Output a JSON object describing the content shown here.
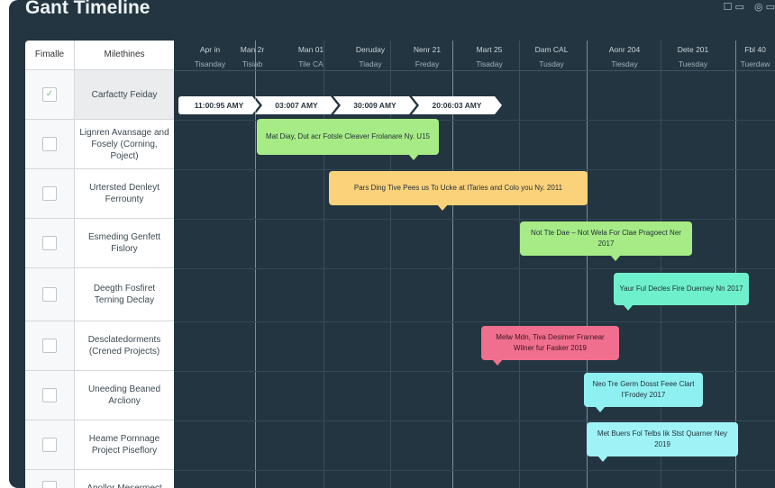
{
  "app": {
    "title": "Gant Timeline",
    "icon_a": "☐ ▭",
    "icon_b": "◎ ▭"
  },
  "table": {
    "col1": "Fimalle",
    "col2": "Milethines",
    "rows": [
      {
        "name": "Carfactty Feiday",
        "checked": "✓"
      },
      {
        "name": "Lignren Avansage and Fosely (Corning, Poject)",
        "checked": ""
      },
      {
        "name": "Urtersted Denleyt Ferrounty",
        "checked": ""
      },
      {
        "name": "Esmeding Genfett Fislory",
        "checked": ""
      },
      {
        "name": "Deegth Fosfiret Terning Declay",
        "checked": ""
      },
      {
        "name": "Desclatedorments (Crened Projects)",
        "checked": ""
      },
      {
        "name": "Uneeding Beaned Arcliony",
        "checked": ""
      },
      {
        "name": "Heame Pornnage Project Piseflory",
        "checked": ""
      },
      {
        "name": "Apollor Mesermect",
        "checked": ""
      }
    ]
  },
  "columns": [
    {
      "d1": "Apr in",
      "d2": "Tisanday"
    },
    {
      "d1": "Man 2r",
      "d2": "Tisiab"
    },
    {
      "d1": "Man 01",
      "d2": "Tile CA"
    },
    {
      "d1": "Deruday",
      "d2": "Tiaday"
    },
    {
      "d1": "Nenr 21",
      "d2": "Freday"
    },
    {
      "d1": "Mart 25",
      "d2": "Tisaday"
    },
    {
      "d1": "Dam CAL",
      "d2": "Tusday"
    },
    {
      "d1": "Aonr 204",
      "d2": "Tiesday"
    },
    {
      "d1": "Dete 201",
      "d2": "Tuesday"
    },
    {
      "d1": "Fbl 40",
      "d2": "Tuerdaw"
    }
  ],
  "milestones": [
    {
      "label": "11:00:95 AMY"
    },
    {
      "label": "03:007 AMY"
    },
    {
      "label": "30:009 AMY"
    },
    {
      "label": "20:06:03 AMY"
    }
  ],
  "events": [
    {
      "text": "Mat Diay, Dut acr Fotsle Cleaver Frolanare Ny. U15"
    },
    {
      "text": "Pars Ding Tive Pees us To Ucke at ITaries and Colo you Ny. 2011"
    },
    {
      "text": "Not Tte Dae – Not Wela For Clae Pragoect Ner 2017"
    },
    {
      "text": "Yaur Ful Decles Fire Duerney Nn 2017"
    },
    {
      "text": "Melw Mdn, Tiva Desimer Frarnear Wilner fur Fasker 2019"
    },
    {
      "text": "Neo Tre Germ Dosst Feee Clart I'Frodey 2017"
    },
    {
      "text": "Met Buers Fol Telbs lik Stst Quarner Ney 2019"
    }
  ],
  "colors": {
    "background": "#233540",
    "green": "#a7eb86",
    "orange": "#fbd27a",
    "teal": "#6ff0cc",
    "pink": "#f06f8e",
    "cyan": "#8ff0f2"
  }
}
